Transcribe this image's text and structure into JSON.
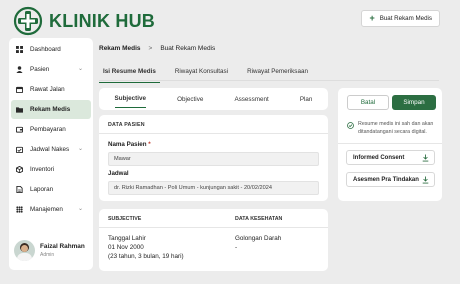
{
  "app": {
    "name": "KLINIK HUB",
    "brand_color": "#1f6b3b",
    "logo_icon": "medical-cross-icon",
    "add_button_label": "Buat Rekam Medis"
  },
  "sidebar": {
    "items": [
      {
        "label": "Dashboard",
        "icon": "grid-icon",
        "active": false,
        "expandable": false
      },
      {
        "label": "Pasien",
        "icon": "person-icon",
        "active": false,
        "expandable": true
      },
      {
        "label": "Rawat Jalan",
        "icon": "calendar-icon",
        "active": false,
        "expandable": false
      },
      {
        "label": "Rekam Medis",
        "icon": "folder-icon",
        "active": true,
        "expandable": false
      },
      {
        "label": "Pembayaran",
        "icon": "wallet-icon",
        "active": false,
        "expandable": false
      },
      {
        "label": "Jadwal Nakes",
        "icon": "calendar-check-icon",
        "active": false,
        "expandable": true
      },
      {
        "label": "Inventori",
        "icon": "box-icon",
        "active": false,
        "expandable": false
      },
      {
        "label": "Laporan",
        "icon": "document-icon",
        "active": false,
        "expandable": false
      },
      {
        "label": "Manajemen",
        "icon": "apps-icon",
        "active": false,
        "expandable": true
      }
    ],
    "user": {
      "name": "Faizal Rahman",
      "role": "Admin"
    }
  },
  "breadcrumb": {
    "root": "Rekam Medis",
    "separator": ">",
    "current": "Buat Rekam Medis"
  },
  "tabs": [
    "Isi Resume Medis",
    "Riwayat Konsultasi",
    "Riwayat Pemeriksaan"
  ],
  "subtabs": [
    "Subjective",
    "Objective",
    "Assessment",
    "Plan"
  ],
  "pasien": {
    "section_title": "DATA PASIEN",
    "nama_label": "Nama Pasien",
    "nama_required": "*",
    "nama_value": "Mawar",
    "jadwal_label": "Jadwal",
    "jadwal_value": "dr. Rizki Ramadhan - Poli Umum - kunjungan sakit - 20/02/2024"
  },
  "subjective": {
    "title": "SUBJECTIVE",
    "tanggal_label": "Tanggal Lahir",
    "tanggal_value": "01 Nov 2000",
    "umur_value": "(23 tahun, 3 bulan, 19 hari)"
  },
  "kesehatan": {
    "title": "DATA KESEHATAN",
    "golongan_label": "Golongan Darah",
    "golongan_value": "-"
  },
  "actions": {
    "batal": "Batal",
    "simpan": "Simpan",
    "note": "Resume medis ini sah dan akan ditandatangani secara digital.",
    "documents": [
      "Informed Consent",
      "Asesmen Pra Tindakan"
    ]
  }
}
